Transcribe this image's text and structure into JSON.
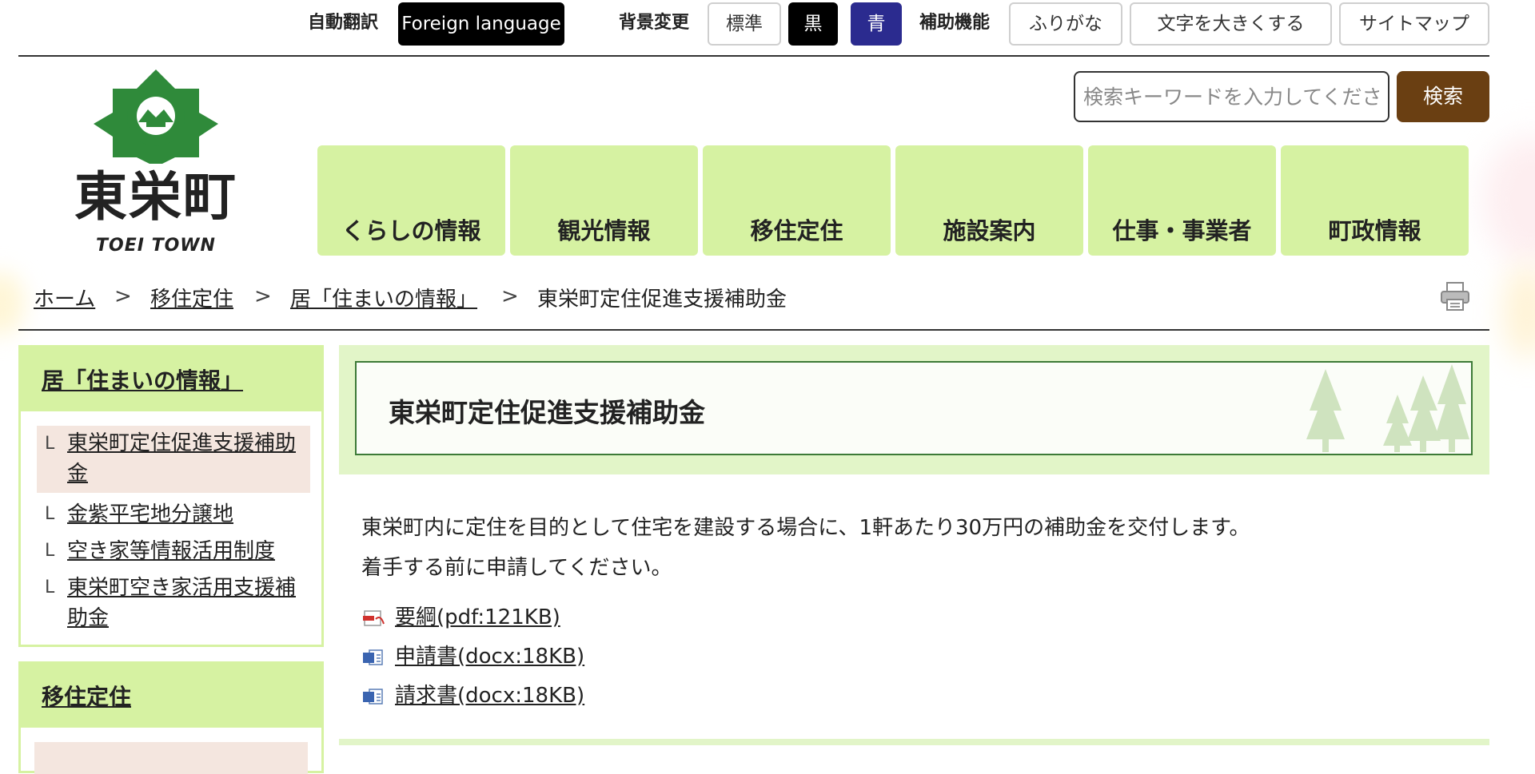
{
  "accessibility_bar": {
    "translate_label": "自動翻訳",
    "foreign_language": "Foreign language",
    "background_label": "背景変更",
    "bg_standard": "標準",
    "bg_black": "黒",
    "bg_blue": "青",
    "assist_label": "補助機能",
    "furigana": "ふりがな",
    "enlarge_text": "文字を大きくする",
    "sitemap": "サイトマップ"
  },
  "logo": {
    "name": "東栄町",
    "subtitle": "TOEI TOWN"
  },
  "search": {
    "placeholder": "検索キーワードを入力してください",
    "button": "検索"
  },
  "global_nav": [
    "くらしの情報",
    "観光情報",
    "移住定住",
    "施設案内",
    "仕事・事業者",
    "町政情報"
  ],
  "breadcrumb": {
    "home": "ホーム",
    "level1": "移住定住",
    "level2": "居「住まいの情報」",
    "current": "東栄町定住促進支援補助金",
    "separator": ">"
  },
  "sidebar": {
    "title": "居「住まいの情報」",
    "marker": "L",
    "items": [
      {
        "label": "東栄町定住促進支援補助金"
      },
      {
        "label": "金紫平宅地分譲地"
      },
      {
        "label": "空き家等情報活用制度"
      },
      {
        "label": "東栄町空き家活用支援補助金"
      }
    ],
    "section2_title": "移住定住"
  },
  "main": {
    "title": "東栄町定住促進支援補助金",
    "paragraph1": "東栄町内に定住を目的として住宅を建設する場合に、1軒あたり30万円の補助金を交付します。",
    "paragraph2": "着手する前に申請してください。",
    "documents": [
      {
        "label": "要綱(pdf:121KB)",
        "type": "pdf"
      },
      {
        "label": "申請書(docx:18KB)",
        "type": "docx"
      },
      {
        "label": "請求書(docx:18KB)",
        "type": "docx"
      }
    ]
  },
  "colors": {
    "nav_green": "#d6f2a2",
    "search_brown": "#6a3f12",
    "blue_button": "#2b2b8f",
    "title_border": "#3d7a37"
  },
  "icons": [
    "print-icon",
    "pdf-icon",
    "word-icon",
    "logo-emblem-icon",
    "trees-decoration"
  ]
}
